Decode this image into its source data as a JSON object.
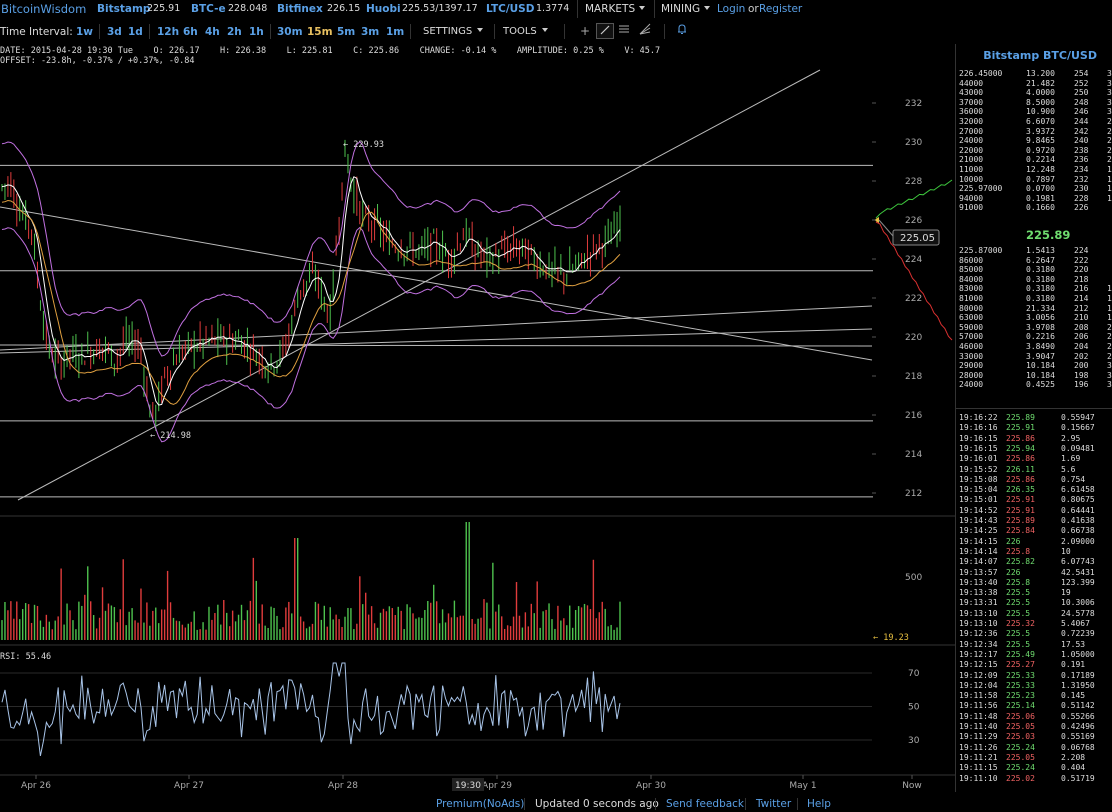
{
  "brand": "BitcoinWisdom",
  "markets": [
    {
      "name": "Bitstamp",
      "value": "225.91"
    },
    {
      "name": "BTC-e",
      "value": "228.048"
    },
    {
      "name": "Bitfinex",
      "value": "226.15"
    },
    {
      "name": "Huobi",
      "value": "225.53/1397.17"
    },
    {
      "name": "LTC/USD",
      "value": "1.3774"
    }
  ],
  "menus": {
    "markets": "MARKETS",
    "mining": "MINING"
  },
  "auth": {
    "login": "Login",
    "or": "or",
    "register": "Register"
  },
  "interval_label": "Time Interval:",
  "intervals": [
    "1w",
    "3d",
    "1d",
    "12h",
    "6h",
    "4h",
    "2h",
    "1h",
    "30m",
    "15m",
    "5m",
    "3m",
    "1m"
  ],
  "active_interval": "15m",
  "settings_label": "SETTINGS",
  "tools_label": "TOOLS",
  "tool_icons": [
    "crosshair-icon",
    "line-tool-icon",
    "hline-tool-icon",
    "fib-tool-icon",
    "bell-icon"
  ],
  "info": {
    "line1": "DATE: 2015-04-28 19:30 Tue    O: 226.17    H: 226.38    L: 225.81    C: 225.86    CHANGE: -0.14 %    AMPLITUDE: 0.25 %    V: 45.7",
    "line2": "OFFSET: -23.8h, -0.37% / +0.37%, -0.84"
  },
  "chart_data": {
    "type": "line",
    "price_axis_ticks": [
      "232",
      "230",
      "228",
      "226",
      "224",
      "222",
      "220",
      "218",
      "216",
      "214",
      "212"
    ],
    "price_range": [
      211.2,
      233.5
    ],
    "volume_axis_tick": "500",
    "rsi_label": "RSI: 55.46",
    "rsi_ticks": [
      "70",
      "50",
      "30"
    ],
    "x_ticks": [
      "Apr 26",
      "Apr 27",
      "Apr 28",
      "Apr 29",
      "Apr 30",
      "May 1",
      "Now"
    ],
    "cursor_time": "19:30",
    "annotations": {
      "high": "229.93",
      "low": "214.98"
    },
    "current_price": "225.05",
    "current_volume": "19.23",
    "colors": {
      "up": "#4ec24e",
      "down": "#e03c3c",
      "bands": "#c070e0",
      "ma_slow": "#e0a040",
      "ma_fast": "#ffffff",
      "rsi": "#a8c4e8"
    }
  },
  "orderbook": {
    "title": "Bitstamp BTC/USD",
    "asks": [
      [
        "226.45000",
        "13.200",
        "254",
        "3"
      ],
      [
        "44000",
        "21.482",
        "252",
        "3"
      ],
      [
        "43000",
        "4.0000",
        "250",
        "3"
      ],
      [
        "37000",
        "8.5000",
        "248",
        "3"
      ],
      [
        "36000",
        "10.900",
        "246",
        "3"
      ],
      [
        "32000",
        "6.6070",
        "244",
        "2"
      ],
      [
        "27000",
        "3.9372",
        "242",
        "2"
      ],
      [
        "24000",
        "9.8465",
        "240",
        "2"
      ],
      [
        "22000",
        "0.9720",
        "238",
        "2"
      ],
      [
        "21000",
        "0.2214",
        "236",
        "2"
      ],
      [
        "11000",
        "12.248",
        "234",
        "1"
      ],
      [
        "10000",
        "0.7897",
        "232",
        "1"
      ],
      [
        "225.97000",
        "0.0700",
        "230",
        "1"
      ],
      [
        "94000",
        "0.1981",
        "228",
        "1"
      ],
      [
        "91000",
        "0.1660",
        "226",
        ""
      ]
    ],
    "last_price": "225.89",
    "bids": [
      [
        "225.87000",
        "1.5413",
        "224",
        ""
      ],
      [
        "86000",
        "6.2647",
        "222",
        ""
      ],
      [
        "85000",
        "0.3180",
        "220",
        ""
      ],
      [
        "84000",
        "0.3180",
        "218",
        ""
      ],
      [
        "83000",
        "0.3180",
        "216",
        "1"
      ],
      [
        "81000",
        "0.3180",
        "214",
        "1"
      ],
      [
        "80000",
        "21.334",
        "212",
        "1"
      ],
      [
        "63000",
        "3.0056",
        "210",
        "1"
      ],
      [
        "59000",
        "3.9708",
        "208",
        "2"
      ],
      [
        "57000",
        "0.2216",
        "206",
        "2"
      ],
      [
        "46000",
        "3.8490",
        "204",
        "2"
      ],
      [
        "33000",
        "3.9047",
        "202",
        "2"
      ],
      [
        "29000",
        "10.184",
        "200",
        "3"
      ],
      [
        "28000",
        "10.184",
        "198",
        "3"
      ],
      [
        "24000",
        "0.4525",
        "196",
        "3"
      ]
    ]
  },
  "trades": [
    [
      "19:16:22",
      "225.89",
      "0.55947",
      "up"
    ],
    [
      "19:16:16",
      "225.91",
      "0.15667",
      "up"
    ],
    [
      "19:16:15",
      "225.86",
      "2.95",
      "down"
    ],
    [
      "19:16:15",
      "225.94",
      "0.09481",
      "up"
    ],
    [
      "19:16:01",
      "225.86",
      "1.69",
      "down"
    ],
    [
      "19:15:52",
      "226.11",
      "5.6",
      "up"
    ],
    [
      "19:15:08",
      "225.86",
      "0.754",
      "down"
    ],
    [
      "19:15:04",
      "226.35",
      "6.61458",
      "up"
    ],
    [
      "19:15:01",
      "225.91",
      "0.80675",
      "down"
    ],
    [
      "19:14:52",
      "225.91",
      "0.64441",
      "down"
    ],
    [
      "19:14:43",
      "225.89",
      "0.41638",
      "down"
    ],
    [
      "19:14:25",
      "225.84",
      "0.66738",
      "down"
    ],
    [
      "19:14:15",
      "226",
      "2.09000",
      "up"
    ],
    [
      "19:14:14",
      "225.8",
      "10",
      "down"
    ],
    [
      "19:14:07",
      "225.82",
      "6.07743",
      "up"
    ],
    [
      "19:13:57",
      "226",
      "42.5431",
      "up"
    ],
    [
      "19:13:40",
      "225.8",
      "123.399",
      "up"
    ],
    [
      "19:13:38",
      "225.5",
      "19",
      "up"
    ],
    [
      "19:13:31",
      "225.5",
      "10.3006",
      "up"
    ],
    [
      "19:13:10",
      "225.5",
      "24.5778",
      "up"
    ],
    [
      "19:13:10",
      "225.32",
      "5.4067",
      "down"
    ],
    [
      "19:12:36",
      "225.5",
      "0.72239",
      "up"
    ],
    [
      "19:12:34",
      "225.5",
      "17.53",
      "up"
    ],
    [
      "19:12:17",
      "225.49",
      "1.05000",
      "up"
    ],
    [
      "19:12:15",
      "225.27",
      "0.191",
      "down"
    ],
    [
      "19:12:09",
      "225.33",
      "0.17189",
      "up"
    ],
    [
      "19:12:04",
      "225.33",
      "1.31950",
      "up"
    ],
    [
      "19:11:58",
      "225.23",
      "0.145",
      "up"
    ],
    [
      "19:11:56",
      "225.14",
      "0.51142",
      "up"
    ],
    [
      "19:11:48",
      "225.06",
      "0.55266",
      "down"
    ],
    [
      "19:11:40",
      "225.05",
      "0.42496",
      "down"
    ],
    [
      "19:11:29",
      "225.03",
      "0.55169",
      "down"
    ],
    [
      "19:11:26",
      "225.24",
      "0.06768",
      "up"
    ],
    [
      "19:11:21",
      "225.05",
      "2.208",
      "down"
    ],
    [
      "19:11:15",
      "225.24",
      "0.404",
      "up"
    ],
    [
      "19:11:10",
      "225.02",
      "0.51719",
      "down"
    ]
  ],
  "footer": {
    "premium": "Premium(NoAds)",
    "updated": "Updated 0 seconds ago",
    "feedback": "Send feedback",
    "twitter": "Twitter",
    "help": "Help"
  }
}
